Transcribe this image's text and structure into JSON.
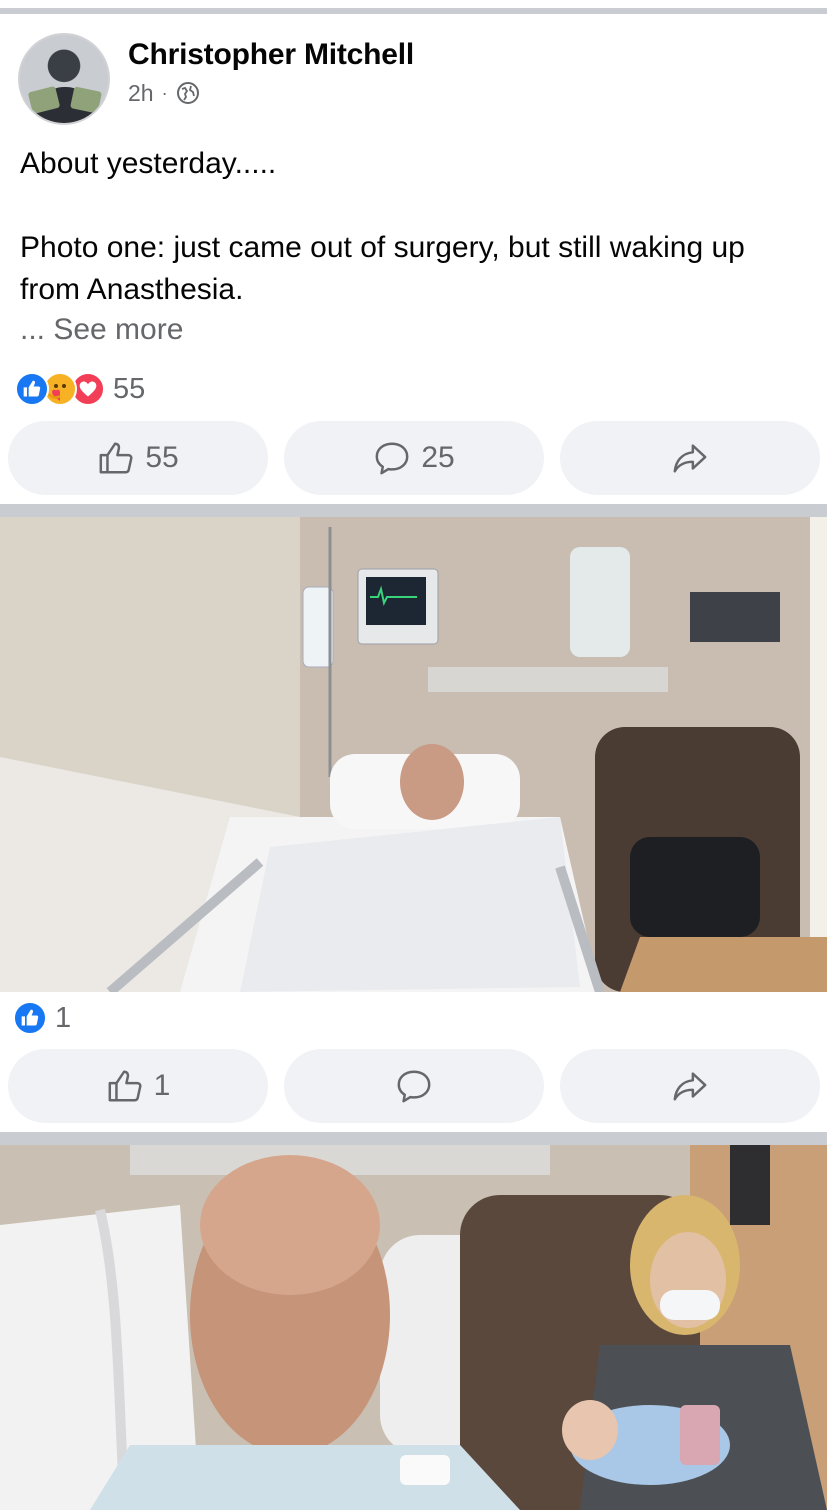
{
  "post": {
    "author": "Christopher Mitchell",
    "time": "2h",
    "separator": "·",
    "text_line1": "About yesterday.....",
    "text_line2": "Photo one: just came out of surgery, but still waking up",
    "text_line3": "from Anasthesia.",
    "see_more": "... See more",
    "reaction_count": "55",
    "like_count": "55",
    "comment_count": "25"
  },
  "photo1": {
    "reaction_count": "1",
    "like_count": "1"
  },
  "icons": {
    "avatar": "profile-photo",
    "privacy": "globe-icon",
    "reactions": [
      "like-reaction-icon",
      "care-reaction-icon",
      "love-reaction-icon"
    ],
    "actions": [
      "like-icon",
      "comment-icon",
      "share-icon"
    ]
  },
  "colors": {
    "like_blue": "#1877f2",
    "love_red": "#f33e58",
    "care_yellow": "#f7b125",
    "button_bg": "#f0f2f5",
    "secondary_text": "#65676b",
    "divider": "#c9ccd1"
  }
}
